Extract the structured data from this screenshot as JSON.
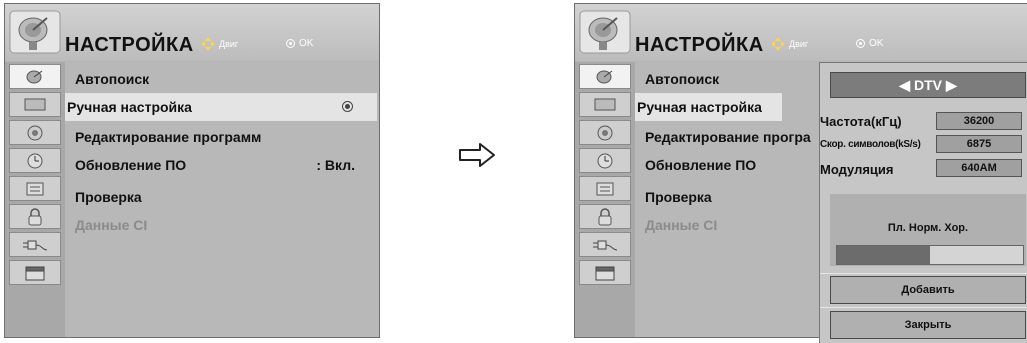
{
  "left_panel": {
    "title": "НАСТРОЙКА",
    "nav_hint": "Двиг",
    "ok_hint": "OK",
    "menu": [
      {
        "label": "Автопоиск",
        "value": "",
        "state": "normal"
      },
      {
        "label": "Ручная настройка",
        "value": "",
        "state": "selected"
      },
      {
        "label": "Редактирование программ",
        "value": "",
        "state": "normal"
      },
      {
        "label": "Обновление ПО",
        "value": ": Вкл.",
        "state": "normal"
      },
      {
        "label": "Проверка",
        "value": "",
        "state": "normal"
      },
      {
        "label": "Данные CI",
        "value": "",
        "state": "disabled"
      }
    ],
    "side_icons": [
      "satellite-icon",
      "screen-icon",
      "speaker-icon",
      "clock-icon",
      "settings-box-icon",
      "lock-icon",
      "plug-icon",
      "clapper-icon"
    ]
  },
  "right_panel": {
    "title": "НАСТРОЙКА",
    "nav_hint": "Двиг",
    "ok_hint": "OK",
    "menu": [
      {
        "label": "Автопоиск"
      },
      {
        "label": "Ручная настройка"
      },
      {
        "label": "Редактирование програ"
      },
      {
        "label": "Обновление ПО"
      },
      {
        "label": "Проверка"
      },
      {
        "label": "Данные CI"
      }
    ],
    "popup": {
      "system": "DTV",
      "frequency_label": "Частота(кГц)",
      "frequency_value": "36200",
      "symbol_rate_label": "Скор. символов(kS/s)",
      "symbol_rate_value": "6875",
      "modulation_label": "Модуляция",
      "modulation_value": "640AM",
      "signal_label": "Пл. Норм. Хор.",
      "signal_level": 0.5,
      "add_label": "Добавить",
      "close_label": "Закрыть"
    }
  },
  "transition_arrow": "arrow-right-icon"
}
